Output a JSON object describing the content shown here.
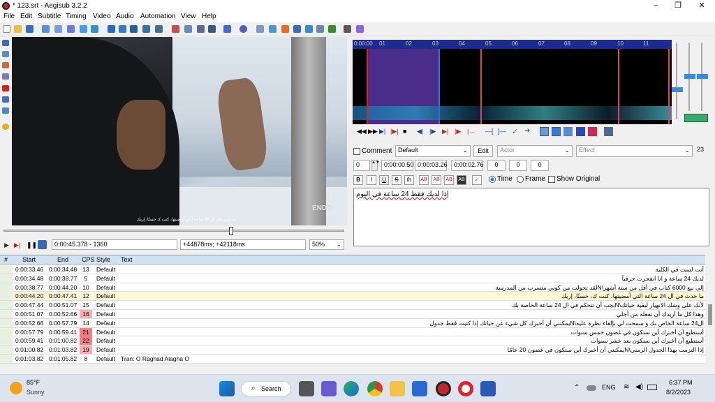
{
  "window": {
    "title": "* 123.srt - Aegisub 3.2.2",
    "minimize": "–",
    "maximize": "❐",
    "close": "✕"
  },
  "menu": [
    "File",
    "Edit",
    "Subtitle",
    "Timing",
    "Video",
    "Audio",
    "Automation",
    "View",
    "Help"
  ],
  "video": {
    "burned_subtitle": "ما حدث في ال 24 ساعة التي أمضيتها، كنت كـ حسنًا، إريك",
    "logo": "ENDO"
  },
  "video_controls": {
    "time": "0:00:45.378 - 1360",
    "offset": "+44878ms; +42118ms",
    "zoom": "50%"
  },
  "audio": {
    "ticks": [
      "0:00:00",
      "01",
      "02",
      "03",
      "04",
      "05",
      "06",
      "07",
      "08",
      "09",
      "10",
      "11"
    ]
  },
  "editor": {
    "comment_label": "Comment",
    "style": "Default",
    "edit_label": "Edit",
    "actor_placeholder": "Actor",
    "effect_placeholder": "Effect",
    "char_count": "23",
    "layer": "0",
    "start": "0:00:00.50",
    "end": "0:00:03.26",
    "duration": "0:00:02.76",
    "margin_l": "0",
    "margin_r": "0",
    "margin_v": "0",
    "bold": "B",
    "italic": "I",
    "underline": "U",
    "strike": "S",
    "fn": "fn",
    "ab": "AB",
    "time_label": "Time",
    "frame_label": "Frame",
    "show_original_label": "Show Original",
    "text": "إذا لديك فقط 24 ساعة في اليوم"
  },
  "grid": {
    "headers": [
      "#",
      "Start",
      "End",
      "CPS",
      "Style",
      "Text"
    ],
    "rows": [
      {
        "n": "17",
        "start": "0:00:33.46",
        "end": "0:00:34.48",
        "cps": "13",
        "style": "Default",
        "text": "أنت لست في الكلية"
      },
      {
        "n": "18",
        "start": "0:00:34.48",
        "end": "0:00:38.77",
        "cps": "5",
        "style": "Default",
        "text": "لديك 24 ساعة و انا انفجرت حرفياً"
      },
      {
        "n": "19",
        "start": "0:00:38.77",
        "end": "0:00:44.20",
        "cps": "10",
        "style": "Default",
        "text": "إلى بيع 6000 كتاب في أقل من ستة أشهر\\Nلقد تحولت من كوني متسرب من المدرسة"
      },
      {
        "n": "20",
        "start": "0:00:44.20",
        "end": "0:00:47.41",
        "cps": "12",
        "style": "Default",
        "text": "ما حدث في ال 24 ساعة التي أمضيتها، كنت ك، حسنًا، إريك"
      },
      {
        "n": "21",
        "start": "0:00:47.44",
        "end": "0:00:51.07",
        "cps": "15",
        "style": "Default",
        "text": "لأنك على وشك الانهيار لبقية حياتك\\Nيجب أن تتحكم في ال 24 ساعة الخاصة بك"
      },
      {
        "n": "22",
        "start": "0:00:51.07",
        "end": "0:00:52.66",
        "cps": "16",
        "style": "Default",
        "text": "وهذا كل ما أريدك أن تفعله من أجلي"
      },
      {
        "n": "23",
        "start": "0:00:52.66",
        "end": "0:00:57.79",
        "cps": "14",
        "style": "Default",
        "text": "ال24 ساعة الخاص بك و سمحت لي بإلقاء نظرة عليه\\Nيمكنني أن أخبرك كل شيء عن حياتك إذا كتبت فقط جدول"
      },
      {
        "n": "24",
        "start": "0:00:57.79",
        "end": "0:00:59.41",
        "cps": "21",
        "style": "Default",
        "text": "أستطيع أن أخبرك أين ستكون في غضون خمس سنوات"
      },
      {
        "n": "25",
        "start": "0:00:59.41",
        "end": "0:01:00.82",
        "cps": "22",
        "style": "Default",
        "text": "أستطيع أن أخبرك أين ستكون بعد عشر سنوات"
      },
      {
        "n": "26",
        "start": "0:01:00.82",
        "end": "0:01:03.82",
        "cps": "19",
        "style": "Default",
        "text": "إذا التزمت بهذا الجدول الزمني\\Nيمكنني أن أخبرك أين ستكون في غضون 20 عامًا"
      },
      {
        "n": "27",
        "start": "0:01:03.82",
        "end": "0:01:05.82",
        "cps": "8",
        "style": "Default",
        "text": "Tran: O Raghad Alagha O"
      }
    ]
  },
  "taskbar": {
    "weather_temp": "85°F",
    "weather_desc": "Sunny",
    "search_label": "Search",
    "lang": "ENG",
    "time": "6:37 PM",
    "date": "8/2/2023"
  }
}
